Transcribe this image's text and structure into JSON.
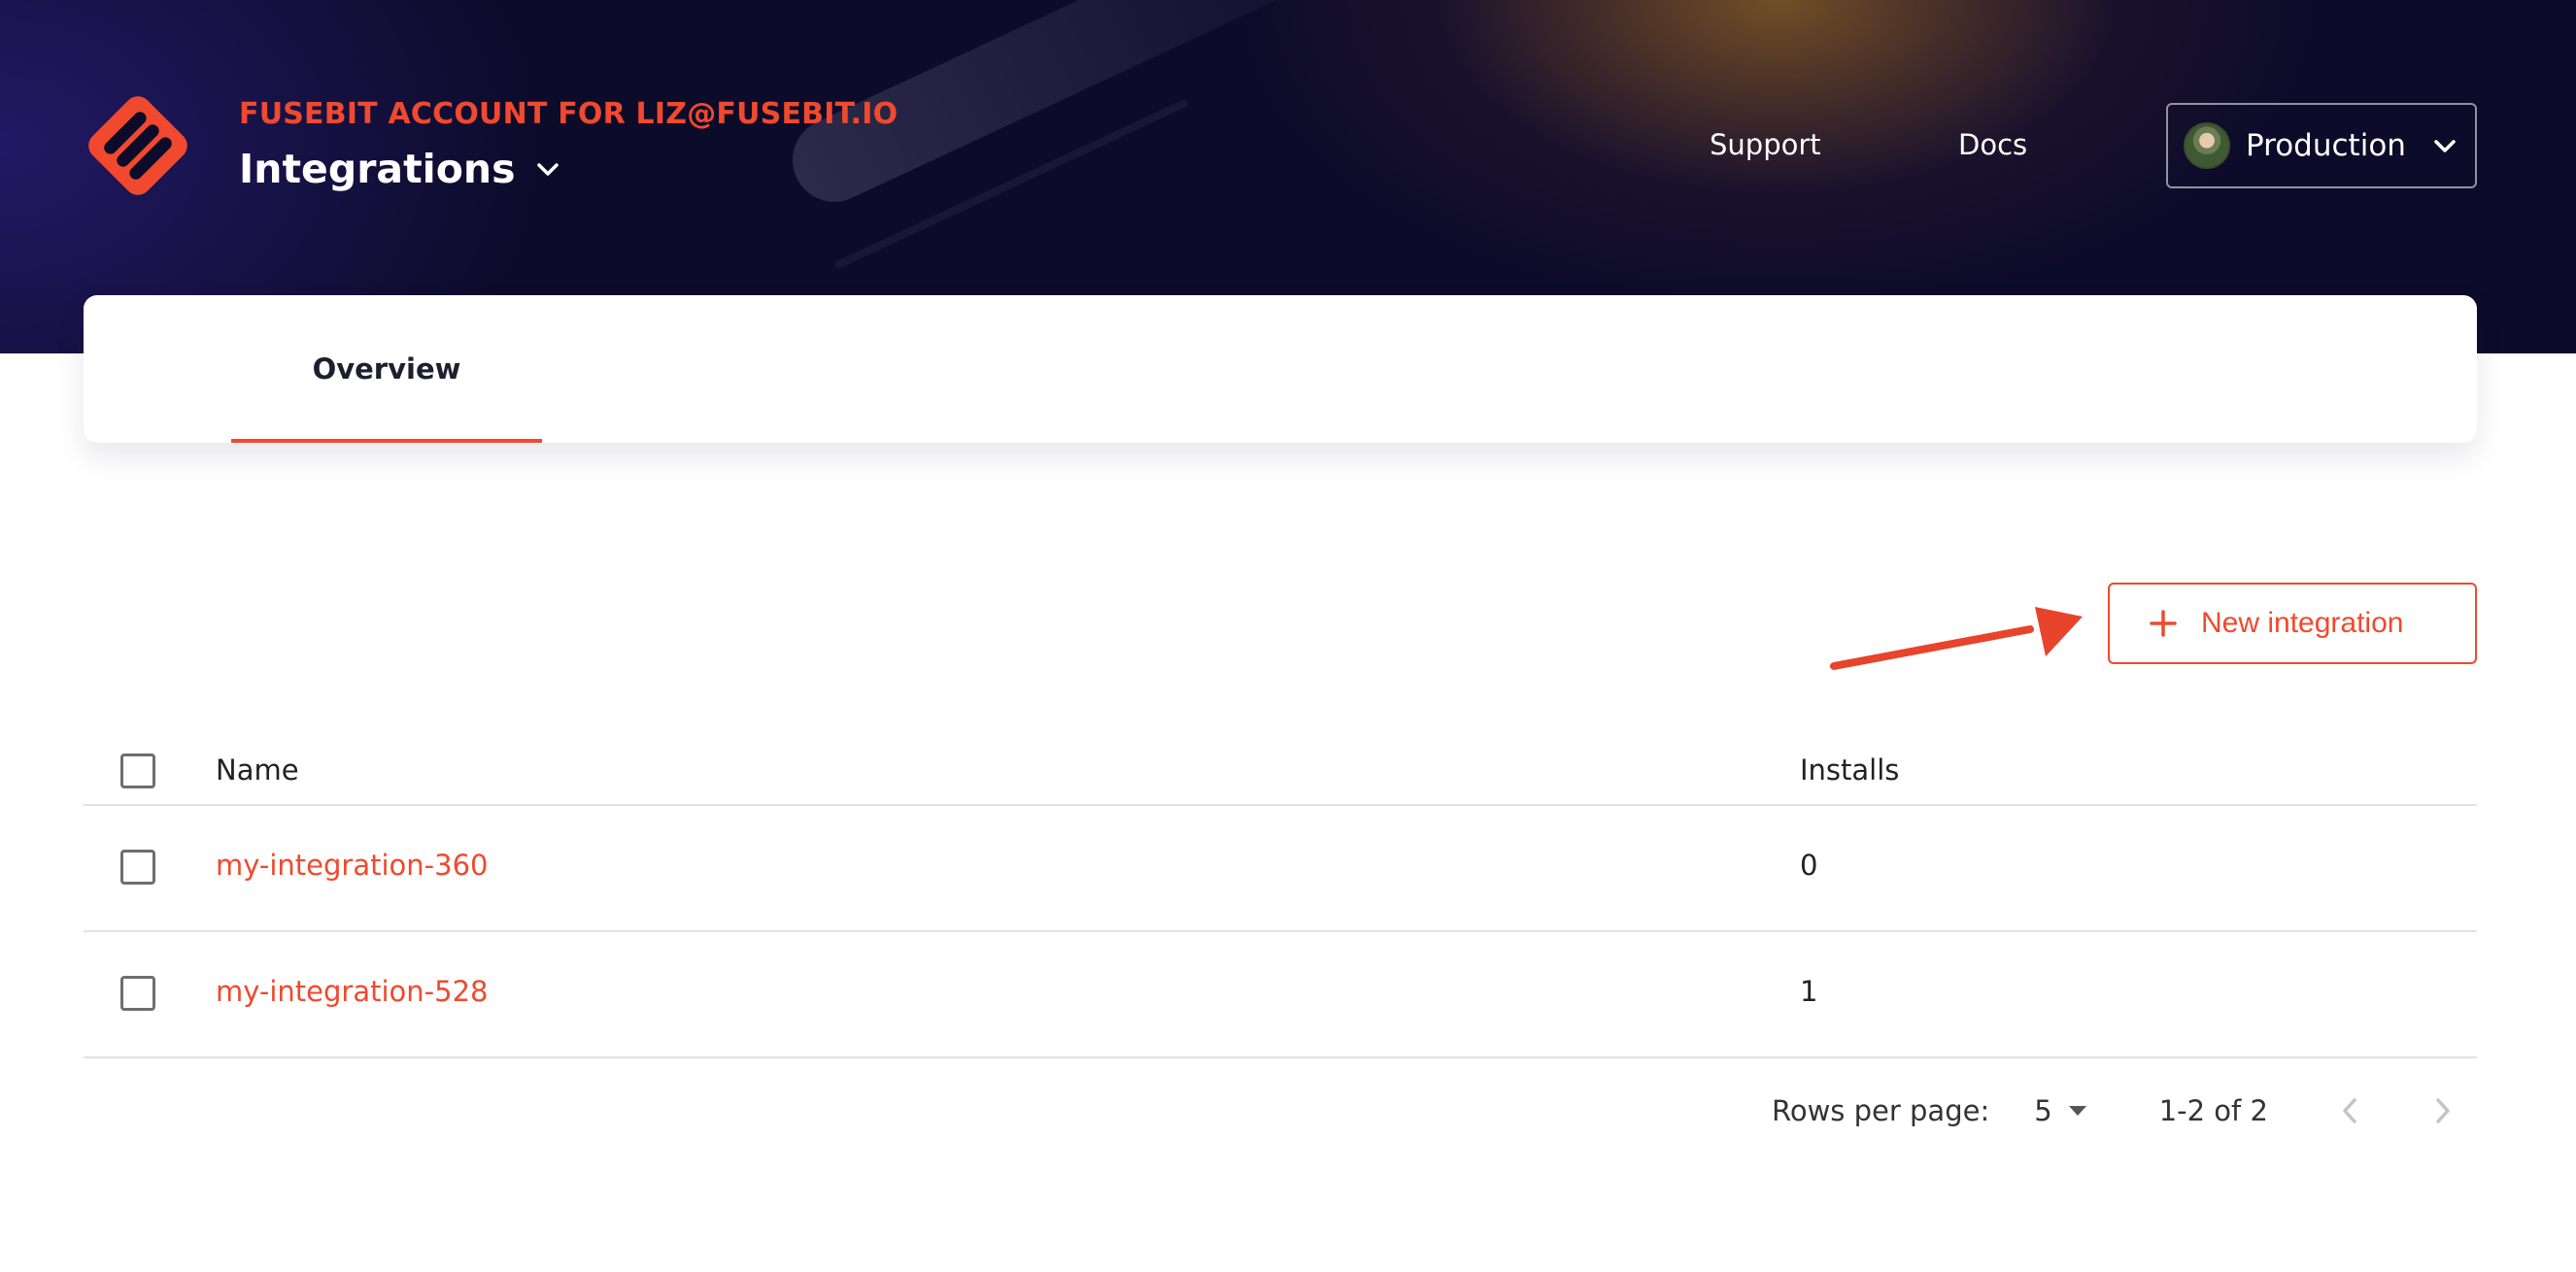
{
  "header": {
    "account_label": "FUSEBIT ACCOUNT FOR LIZ@FUSEBIT.IO",
    "title": "Integrations",
    "title_icon": "chevron-down-icon",
    "logo_icon": "fusebit-logo-icon",
    "nav": {
      "support": "Support",
      "docs": "Docs"
    },
    "environment": {
      "label": "Production",
      "icon": "chevron-down-icon"
    }
  },
  "tabs": [
    {
      "label": "Overview",
      "active": true
    }
  ],
  "actions": {
    "new_integration": {
      "label": "New integration",
      "icon": "plus-icon"
    },
    "annotation_icon": "arrow-pointer-icon"
  },
  "table": {
    "columns": [
      "Name",
      "Installs"
    ],
    "rows": [
      {
        "name": "my-integration-360",
        "installs": "0"
      },
      {
        "name": "my-integration-528",
        "installs": "1"
      }
    ]
  },
  "pagination": {
    "rows_per_page_label": "Rows per page:",
    "rows_per_page": "5",
    "range": "1-2 of 2",
    "prev_icon": "chevron-left-icon",
    "next_icon": "chevron-right-icon"
  },
  "colors": {
    "accent": "#f0492e",
    "hero_background": "#0d0b2a",
    "text": "#222222",
    "divider": "#e2e2e4"
  }
}
